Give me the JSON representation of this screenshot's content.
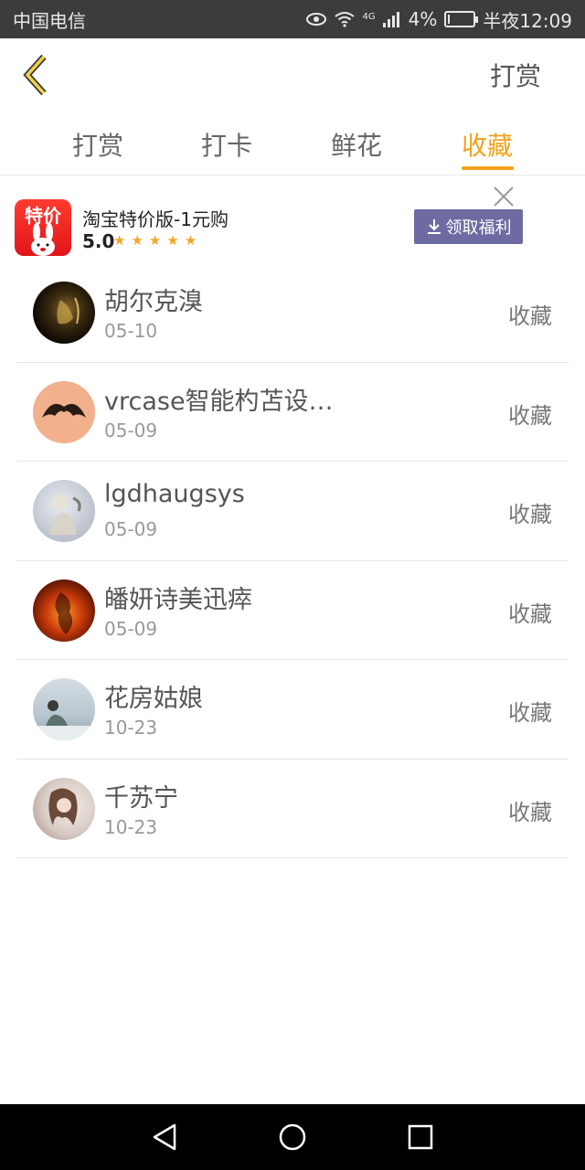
{
  "status_bar": {
    "carrier": "中国电信",
    "network": "4G",
    "battery": "4%",
    "time": "半夜12:09"
  },
  "header": {
    "back_icon": "chevron-left-icon",
    "action": "打赏"
  },
  "tabs": [
    {
      "label": "打赏",
      "active": false
    },
    {
      "label": "打卡",
      "active": false
    },
    {
      "label": "鲜花",
      "active": false
    },
    {
      "label": "收藏",
      "active": true
    }
  ],
  "ad": {
    "logo_text": "特价",
    "title": "淘宝特价版-1元购",
    "rating": "5.0",
    "stars": "★★★★★",
    "button": "领取福利",
    "close_icon": "close-icon"
  },
  "list": [
    {
      "name": "胡尔克溴",
      "date": "05-10",
      "action": "收藏",
      "avatar_color": "#1a1208"
    },
    {
      "name": "vrcase智能杓苫设…",
      "date": "05-09",
      "action": "收藏",
      "avatar_color": "#f2b08c"
    },
    {
      "name": "lgdhaugsys",
      "date": "05-09",
      "action": "收藏",
      "avatar_color": "#c8ccd6"
    },
    {
      "name": "皤妍诗美迅瘁",
      "date": "05-09",
      "action": "收藏",
      "avatar_color": "#b8320c"
    },
    {
      "name": "花房姑娘",
      "date": "10-23",
      "action": "收藏",
      "avatar_color": "#b9c9d4"
    },
    {
      "name": "千苏宁",
      "date": "10-23",
      "action": "收藏",
      "avatar_color": "#d8cbc4"
    }
  ],
  "colors": {
    "accent": "#f0a21e",
    "ad_button": "#6e6ba3",
    "status_bar": "#3c3c3c",
    "nav_bar": "#000000"
  }
}
